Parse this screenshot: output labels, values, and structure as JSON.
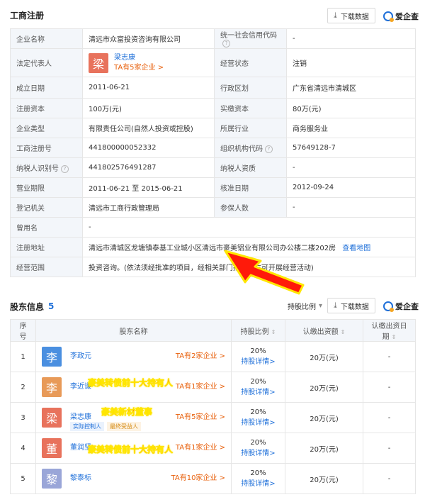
{
  "section1": {
    "title": "工商注册",
    "download": "下载数据",
    "brand": "爱企查"
  },
  "biz": {
    "company_name_k": "企业名称",
    "company_name_v": "清远市众富投资咨询有限公司",
    "credit_code_k": "统一社会信用代码",
    "credit_code_v": "-",
    "legal_rep_k": "法定代表人",
    "legal_rep_avatar": "梁",
    "legal_rep_name": "梁志康",
    "legal_rep_companies": "TA有5家企业 >",
    "status_k": "经营状态",
    "status_v": "注销",
    "founded_k": "成立日期",
    "founded_v": "2011-06-21",
    "region_k": "行政区划",
    "region_v": "广东省清远市清城区",
    "capital_k": "注册资本",
    "capital_v": "100万(元)",
    "paid_k": "实缴资本",
    "paid_v": "80万(元)",
    "type_k": "企业类型",
    "type_v": "有限责任公司(自然人投资或控股)",
    "industry_k": "所属行业",
    "industry_v": "商务服务业",
    "regno_k": "工商注册号",
    "regno_v": "441800000052332",
    "orgcode_k": "组织机构代码",
    "orgcode_v": "57649128-7",
    "taxid_k": "纳税人识别号",
    "taxid_v": "441802576491287",
    "taxq_k": "纳税人资质",
    "taxq_v": "-",
    "term_k": "营业期限",
    "term_v": "2011-06-21 至 2015-06-21",
    "approved_k": "核准日期",
    "approved_v": "2012-09-24",
    "authority_k": "登记机关",
    "authority_v": "清远市工商行政管理局",
    "insured_k": "参保人数",
    "insured_v": "-",
    "formername_k": "曾用名",
    "formername_v": "-",
    "address_k": "注册地址",
    "address_v": "清远市清城区龙塘镇泰基工业城小区清远市豪美铝业有限公司办公楼二楼202房",
    "address_map": "查看地图",
    "scope_k": "经营范围",
    "scope_v": "投资咨询。(依法须经批准的项目，经相关部门批准后方可开展经营活动)"
  },
  "section2": {
    "title": "股东信息",
    "count": "5",
    "filter": "持股比例",
    "download": "下载数据",
    "brand": "爱企查"
  },
  "shareholders": {
    "headers": [
      "序号",
      "股东名称",
      "持股比例",
      "认缴出资额",
      "认缴出资日期"
    ],
    "detail": "持股详情>",
    "rows": [
      {
        "no": "1",
        "avatar": "李",
        "color": "#4a8fe0",
        "name": "李政元",
        "ta": "TA有2家企业 >",
        "pct": "20%",
        "amount": "20万(元)",
        "date": "-"
      },
      {
        "no": "2",
        "avatar": "李",
        "color": "#e89a58",
        "name": "李近谦",
        "ta": "TA有1家企业 >",
        "pct": "20%",
        "amount": "20万(元)",
        "date": "-"
      },
      {
        "no": "3",
        "avatar": "梁",
        "color": "#e8725c",
        "name": "梁志康",
        "ta": "TA有5家企业 >",
        "pct": "20%",
        "amount": "20万(元)",
        "date": "-",
        "tag1": "实际控制人",
        "tag2": "最终受益人"
      },
      {
        "no": "4",
        "avatar": "董",
        "color": "#e8725c",
        "name": "董润坚",
        "ta": "TA有1家企业 >",
        "pct": "20%",
        "amount": "20万(元)",
        "date": "-"
      },
      {
        "no": "5",
        "avatar": "黎",
        "color": "#9aa6d8",
        "name": "黎泰标",
        "ta": "TA有10家企业 >",
        "pct": "20%",
        "amount": "20万(元)",
        "date": "-"
      }
    ]
  },
  "annotations": {
    "row2": "豪美转债前十大持有人",
    "row3": "豪美新材董事",
    "row4": "豪美转债前十大持有人"
  },
  "colors": {
    "accent": "#1e6fd9",
    "orange": "#e8600c",
    "arrow_fill": "#ff1a0a",
    "arrow_edge": "#ffe600"
  }
}
